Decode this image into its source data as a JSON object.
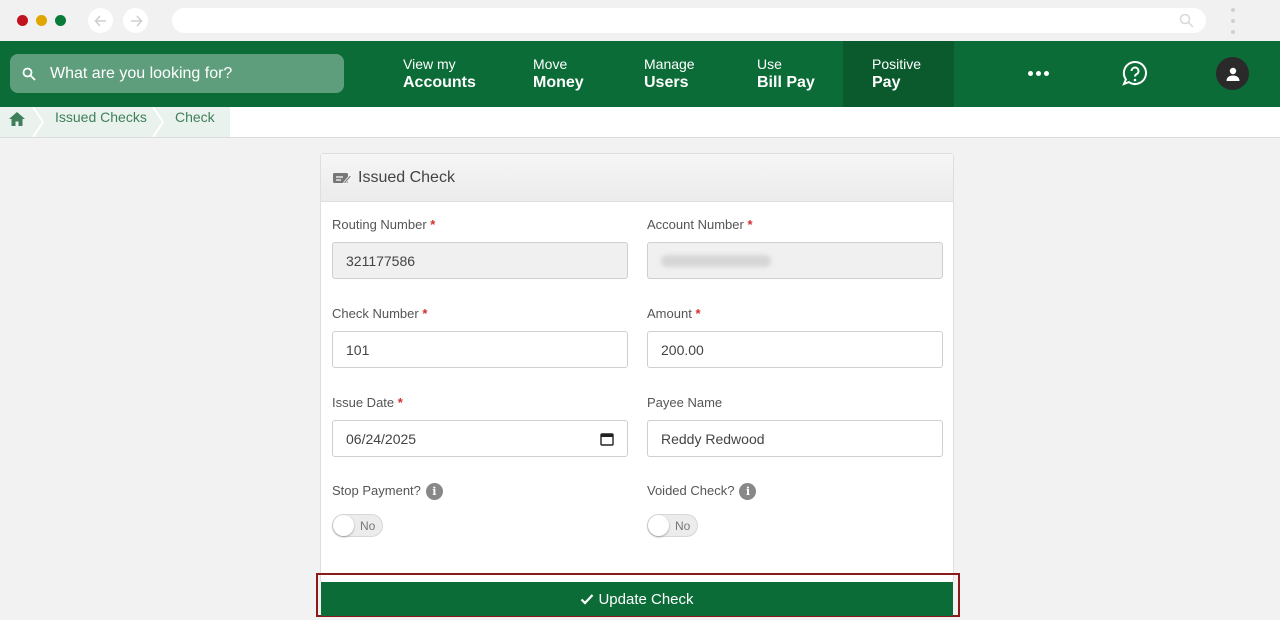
{
  "search": {
    "placeholder": "What are you looking for?"
  },
  "nav": [
    {
      "line1": "View my",
      "line2": "Accounts"
    },
    {
      "line1": "Move",
      "line2": "Money"
    },
    {
      "line1": "Manage",
      "line2": "Users"
    },
    {
      "line1": "Use",
      "line2": "Bill Pay"
    },
    {
      "line1": "Positive",
      "line2": "Pay"
    }
  ],
  "breadcrumb": {
    "items": [
      "Issued Checks",
      "Check"
    ]
  },
  "card": {
    "title": "Issued Check",
    "routing": {
      "label": "Routing Number",
      "value": "321177586"
    },
    "account": {
      "label": "Account Number"
    },
    "check_number": {
      "label": "Check Number",
      "value": "101"
    },
    "amount": {
      "label": "Amount",
      "value": "200.00"
    },
    "issue_date": {
      "label": "Issue Date",
      "value": "06/24/2025"
    },
    "payee": {
      "label": "Payee Name",
      "value": "Reddy Redwood"
    },
    "stop_payment": {
      "label": "Stop Payment?",
      "state": "No"
    },
    "voided": {
      "label": "Voided Check?",
      "state": "No"
    },
    "required_mark": "*",
    "info_glyph": "i"
  },
  "update_button": {
    "label": "Update Check"
  },
  "colors": {
    "brand_green": "#0b6c37",
    "active_nav": "#0a5a2d",
    "required": "#d32f2f",
    "highlight": "#8b1a1a"
  }
}
